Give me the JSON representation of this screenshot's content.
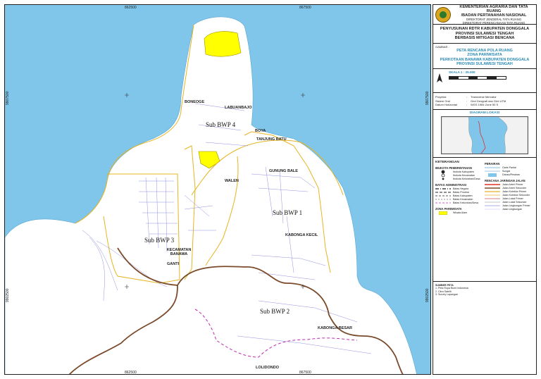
{
  "map": {
    "coords_top": [
      "862500",
      "867500"
    ],
    "coords_bottom": [
      "862500",
      "867500"
    ],
    "coords_left": [
      "9907500",
      "9902500"
    ],
    "coords_right": [
      "9907500",
      "9902500"
    ],
    "places": [
      {
        "id": "boneoge",
        "name": "BONEOGE"
      },
      {
        "id": "labuanbajo",
        "name": "LABUANBAJO"
      },
      {
        "id": "boya",
        "name": "BOYA"
      },
      {
        "id": "tanjung-batu",
        "name": "TANJUNG BATU"
      },
      {
        "id": "gunung-bale",
        "name": "GUNUNG BALE"
      },
      {
        "id": "wani",
        "name": "WALEN"
      },
      {
        "id": "kabonga-kecil",
        "name": "KABONGA KECIL"
      },
      {
        "id": "kecamatan-banawa",
        "name": "KECAMATAN BANAWA"
      },
      {
        "id": "ganti",
        "name": "GANTI"
      },
      {
        "id": "kabonga-besar",
        "name": "KABONGA BESAR"
      },
      {
        "id": "loli-dondo",
        "name": "LOLIDONDO"
      }
    ],
    "bwp": [
      "Sub BWP 4",
      "Sub BWP 1",
      "Sub BWP 3",
      "Sub BWP 2"
    ],
    "colors": {
      "sea": "#7fc6ea",
      "land": "#ffffff",
      "tourism": "#ffff00",
      "boundary": "#e6b422",
      "arterial": "#7a4a2a",
      "local_road": "#9090e0",
      "admin_dashed": "#c02ab0"
    }
  },
  "legend": {
    "ministry": {
      "line1": "KEMENTERIAN AGRARIA DAN TATA RUANG",
      "line2": "/BADAN PERTANAHAN NASIONAL",
      "line3": "DIREKTORAT JENDERAL TATA RUANG",
      "line4": "DIREKTORAT PERENCANAAN TATA RUANG"
    },
    "title_lines": [
      "PENYUSUNAN RDTR KABUPATEN DONGGALA",
      "PROVINSI SULAWESI TENGAH",
      "BERBASIS MITIGASI BENCANA"
    ],
    "gambar_label": "GAMBAR :",
    "gambar_lines": [
      "PETA RENCANA POLA RUANG",
      "ZONA PARIWISATA",
      "PERKOTAAN BANAWA KABUPATEN DONGGALA",
      "PROVINSI SULAWESI TENGAH"
    ],
    "skala": "SKALA 1 : 25.000",
    "projection": [
      {
        "k": "Proyeksi",
        "v": "Transverse Mercator"
      },
      {
        "k": "Sistem Grid",
        "v": "Grid Geografi dan Grid UTM"
      },
      {
        "k": "Datum Horizontal",
        "v": "WGS 1984 Zone 50 S"
      }
    ],
    "inset_title": "DIAGRAM LOKASI",
    "keterangan": "KETERANGAN",
    "ibukota_title": "IBUKOTA PEMERINTAHAN",
    "ibukota": [
      "Ibukota Kabupaten",
      "Ibukota Kecamatan",
      "Ibukota Kelurahan/Desa"
    ],
    "batas_title": "BATAS ADMINISTRASI",
    "batas": [
      "Batas Negara",
      "Batas Provinsi",
      "Batas Kabupaten",
      "Batas Kecamatan",
      "Batas Kelurahan/Desa"
    ],
    "zona_title": "ZONA PARIWISATA",
    "zona": [
      "Wisata Alam"
    ],
    "perairan_title": "PERAIRAN",
    "perairan": [
      "Garis Pantai",
      "Sungai",
      "Danau/Perairan"
    ],
    "jalan_title": "RENCANA JARINGAN JALAN",
    "jalan": [
      "Jalan Arteri Primer",
      "Jalan Arteri Sekunder",
      "Jalan Kolektor Primer",
      "Jalan Kolektor Sekunder",
      "Jalan Lokal Primer",
      "Jalan Lokal Sekunder",
      "Jalan Lingkungan Primer",
      "Jalan Lingkungan"
    ],
    "sources_title": "SUMBER PETA",
    "sources": [
      "1. Peta Rupa Bumi Indonesia",
      "2. Citra Satelit",
      "3. Survey Lapangan"
    ]
  }
}
